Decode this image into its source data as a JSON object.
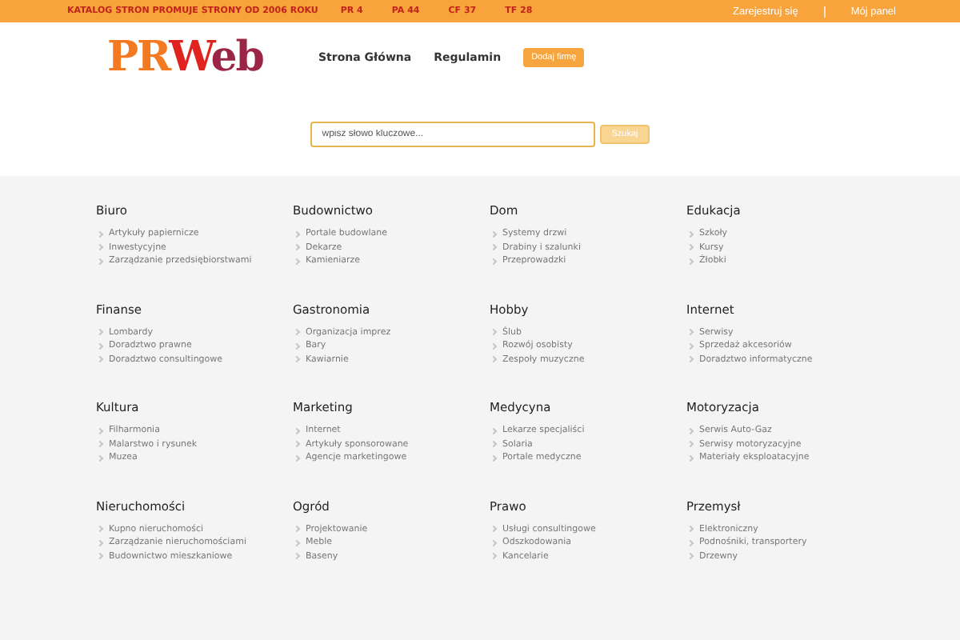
{
  "top_bar": {
    "tagline": "KATALOG STRON PROMUJE STRONY OD 2006 ROKU",
    "stats": [
      "PR 4",
      "PA 44",
      "CF 37",
      "TF 28"
    ],
    "links": [
      "Zarejestruj się",
      "Mój panel"
    ]
  },
  "header": {
    "logo": [
      "PR",
      "W",
      "eb"
    ],
    "nav": [
      {
        "label": "Strona Główna",
        "kind": "link"
      },
      {
        "label": "Regulamin",
        "kind": "link"
      },
      {
        "label": "Dodaj firmę",
        "kind": "button"
      }
    ]
  },
  "search": {
    "placeholder": "wpisz słowo kluczowe...",
    "button": "Szukaj"
  },
  "categories": [
    {
      "title": "Biuro",
      "items": [
        "Artykuły papiernicze",
        "Inwestycyjne",
        "Zarządzanie przedsiębiorstwami"
      ]
    },
    {
      "title": "Budownictwo",
      "items": [
        "Portale budowlane",
        "Dekarze",
        "Kamieniarze"
      ]
    },
    {
      "title": "Dom",
      "items": [
        "Systemy drzwi",
        "Drabiny i szalunki",
        "Przeprowadzki"
      ]
    },
    {
      "title": "Edukacja",
      "items": [
        "Szkoły",
        "Kursy",
        "Żłobki"
      ]
    },
    {
      "title": "Finanse",
      "items": [
        "Lombardy",
        "Doradztwo prawne",
        "Doradztwo consultingowe"
      ]
    },
    {
      "title": "Gastronomia",
      "items": [
        "Organizacja imprez",
        "Bary",
        "Kawiarnie"
      ]
    },
    {
      "title": "Hobby",
      "items": [
        "Ślub",
        "Rozwój osobisty",
        "Zespoły muzyczne"
      ]
    },
    {
      "title": "Internet",
      "items": [
        "Serwisy",
        "Sprzedaż akcesoriów",
        "Doradztwo informatyczne"
      ]
    },
    {
      "title": "Kultura",
      "items": [
        "Filharmonia",
        "Malarstwo i rysunek",
        "Muzea"
      ]
    },
    {
      "title": "Marketing",
      "items": [
        "Internet",
        "Artykuły sponsorowane",
        "Agencje marketingowe"
      ]
    },
    {
      "title": "Medycyna",
      "items": [
        "Lekarze specjaliści",
        "Solaria",
        "Portale medyczne"
      ]
    },
    {
      "title": "Motoryzacja",
      "items": [
        "Serwis Auto-Gaz",
        "Serwisy motoryzacyjne",
        "Materiały eksploatacyjne"
      ]
    },
    {
      "title": "Nieruchomości",
      "items": [
        "Kupno nieruchomości",
        "Zarządzanie nieruchomościami",
        "Budownictwo mieszkaniowe"
      ]
    },
    {
      "title": "Ogród",
      "items": [
        "Projektowanie",
        "Meble",
        "Baseny"
      ]
    },
    {
      "title": "Prawo",
      "items": [
        "Usługi consultingowe",
        "Odszkodowania",
        "Kancelarie"
      ]
    },
    {
      "title": "Przemysł",
      "items": [
        "Elektroniczny",
        "Podnośniki, transportery",
        "Drzewny"
      ]
    }
  ]
}
